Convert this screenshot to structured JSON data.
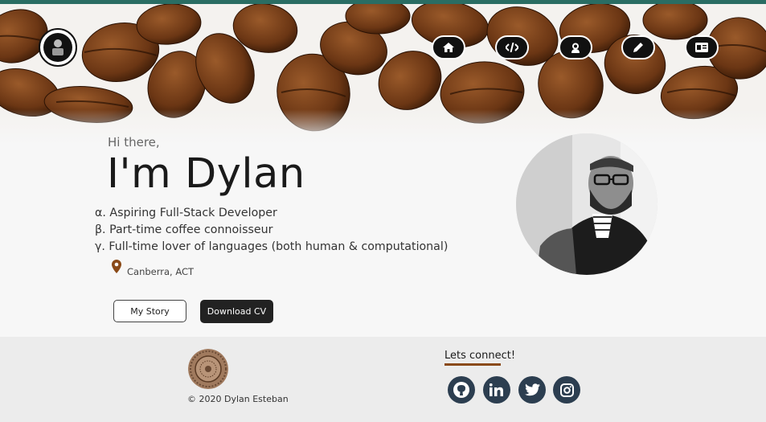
{
  "nav": {
    "items": [
      {
        "icon": "home-icon",
        "label": "Home"
      },
      {
        "icon": "code-icon",
        "label": "Code"
      },
      {
        "icon": "user-astronaut-icon",
        "label": "About"
      },
      {
        "icon": "pen-icon",
        "label": "Blog"
      },
      {
        "icon": "id-card-icon",
        "label": "Contact"
      }
    ]
  },
  "hero": {
    "greeting": "Hi there,",
    "name": "I'm Dylan",
    "bullets": [
      "α. Aspiring Full-Stack Developer",
      "β. Part-time coffee connoisseur",
      "γ. Full-time lover of languages (both human & computational)"
    ],
    "location": "Canberra, ACT",
    "story_button": "My Story",
    "cv_button": "Download CV"
  },
  "footer": {
    "copyright": "© 2020 Dylan Esteban",
    "connect_heading": "Lets connect!",
    "socials": [
      "github-icon",
      "linkedin-icon",
      "twitter-icon",
      "instagram-icon"
    ]
  },
  "colors": {
    "accent": "#8a4a18",
    "topbar": "#2a6d63",
    "social_bg": "#2c3e50",
    "dark": "#222222"
  }
}
